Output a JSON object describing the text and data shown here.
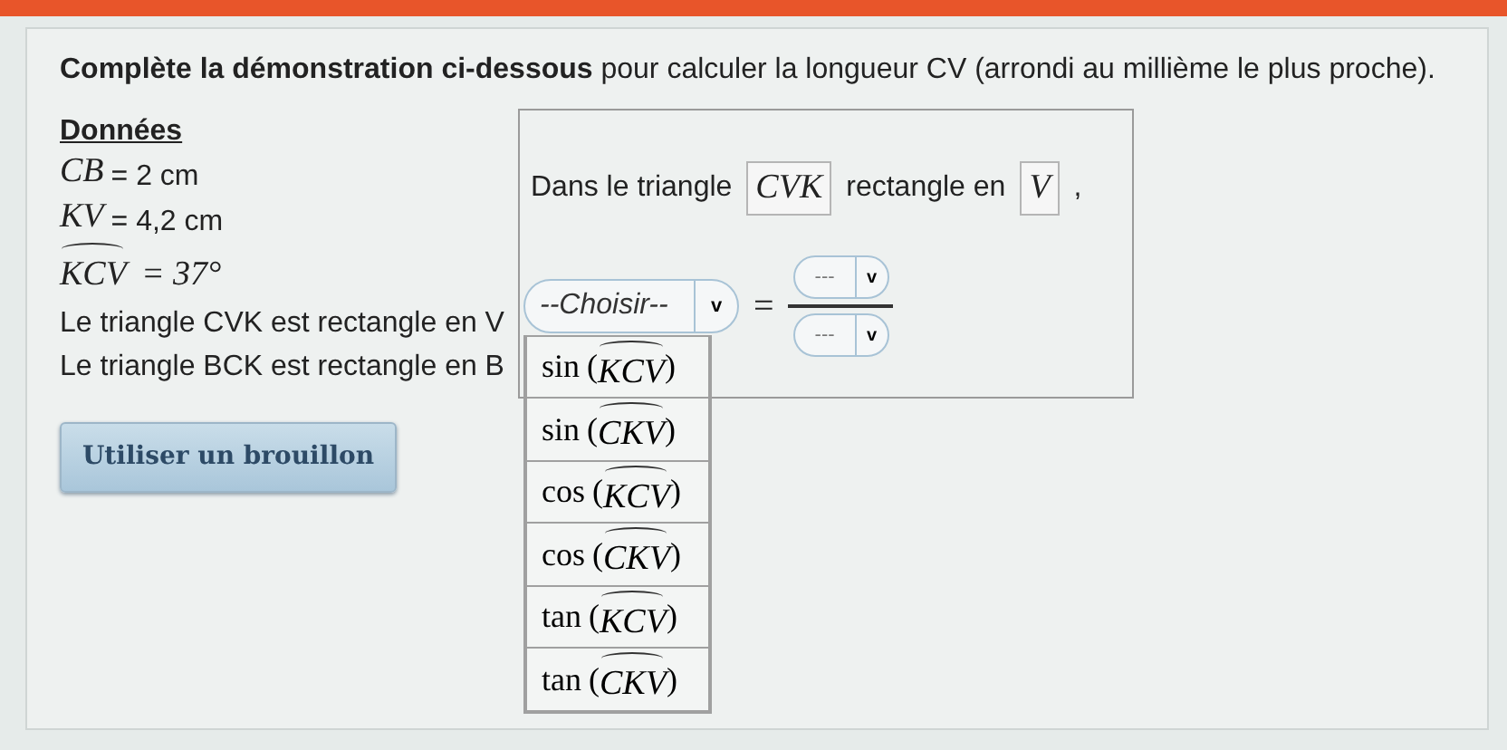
{
  "instruction": "**Complète la démonstration ci-dessous** pour calculer la longueur CV (arrondi au millième le plus proche).",
  "givens": {
    "heading": "Données",
    "items": [
      {
        "kind": "length",
        "symbol": "CB",
        "rest": "= 2 cm"
      },
      {
        "kind": "length",
        "symbol": "KV",
        "rest": "= 4,2 cm"
      },
      {
        "kind": "angle",
        "symbol": "KCV",
        "rest": "= 37°"
      },
      {
        "kind": "text",
        "text": "Le triangle CVK est rectangle en V"
      },
      {
        "kind": "text",
        "text": "Le triangle BCK est rectangle en B"
      }
    ]
  },
  "draft_button": "Utiliser un brouillon",
  "statement": {
    "before": "Dans le triangle",
    "triangle": "CVK",
    "middle": "rectangle en",
    "vertex": "V",
    "after": ","
  },
  "ratio_select": {
    "placeholder": "--Choisir--",
    "caret": "v",
    "expanded": true,
    "options": [
      {
        "func": "sin",
        "open": "(",
        "angle": "KCV",
        "close": ")",
        "selected": false
      },
      {
        "func": "sin",
        "open": "(",
        "angle": "CKV",
        "close": ")",
        "selected": false
      },
      {
        "func": "cos",
        "open": "(",
        "angle": "KCV",
        "close": ")",
        "selected": false
      },
      {
        "func": "cos",
        "open": "(",
        "angle": "CKV",
        "close": ")",
        "selected": false
      },
      {
        "func": "tan",
        "open": "(",
        "angle": "KCV",
        "close": ")",
        "selected": false
      },
      {
        "func": "tan",
        "open": "(",
        "angle": "CKV",
        "close": ")",
        "selected": false
      }
    ]
  },
  "equals": "=",
  "fraction": {
    "numerator": {
      "placeholder": "---",
      "caret": "v"
    },
    "denominator": {
      "placeholder": "---",
      "caret": "v"
    }
  }
}
